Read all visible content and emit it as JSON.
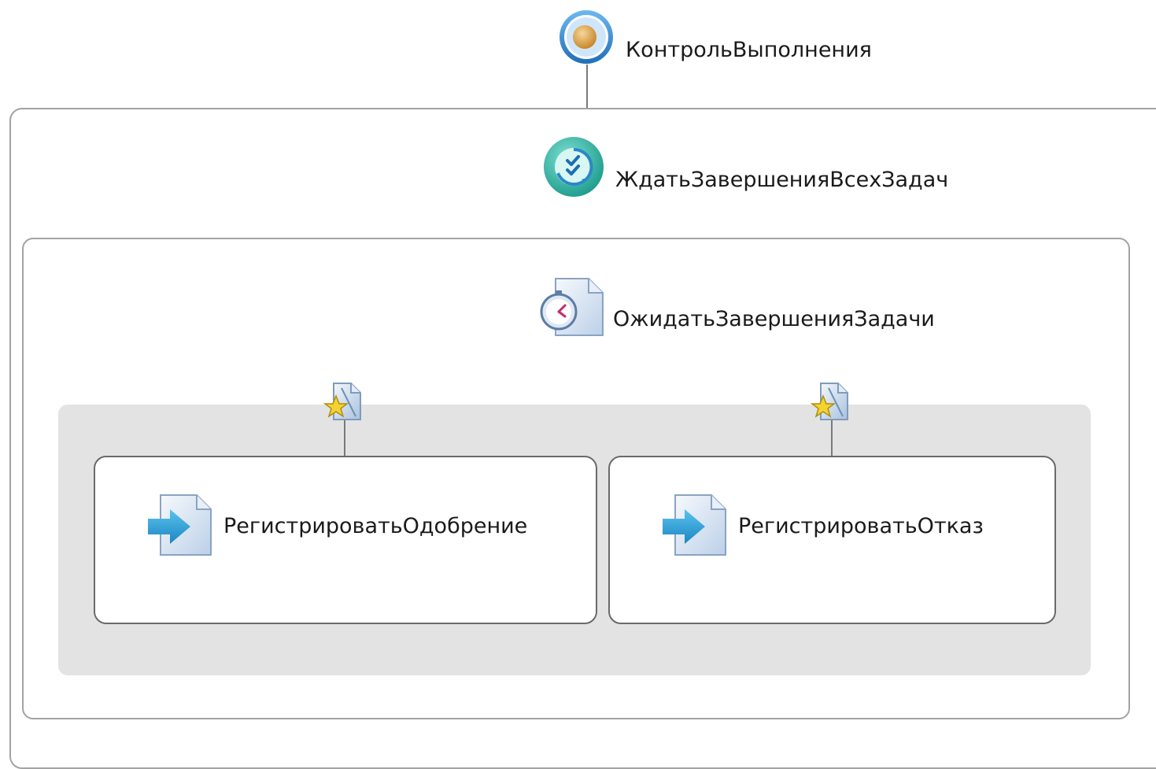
{
  "workflow": {
    "root_activity": {
      "label": "КонтрольВыполнения",
      "icon": "state-circle-icon"
    },
    "wait_all_activity": {
      "label": "ЖдатьЗавершенияВсехЗадач",
      "icon": "replicator-check-icon"
    },
    "wait_task_activity": {
      "label": "ОжидатьЗавершенияЗадачи",
      "icon": "stopwatch-document-icon"
    },
    "event_branches": [
      {
        "trigger_icon": "event-star-icon",
        "activity": {
          "label": "РегистрироватьОдобрение",
          "icon": "arrow-document-icon"
        }
      },
      {
        "trigger_icon": "event-star-icon",
        "activity": {
          "label": "РегистрироватьОтказ",
          "icon": "arrow-document-icon"
        }
      }
    ]
  },
  "colors": {
    "root_ring": "#3d8fd4",
    "root_core": "#e0a64a",
    "replicator": "#2eb4a6",
    "arrow": "#2e9fd6",
    "star": "#f4d230",
    "listen_fill": "#e3e3e3",
    "border": "#a3a3a3"
  }
}
